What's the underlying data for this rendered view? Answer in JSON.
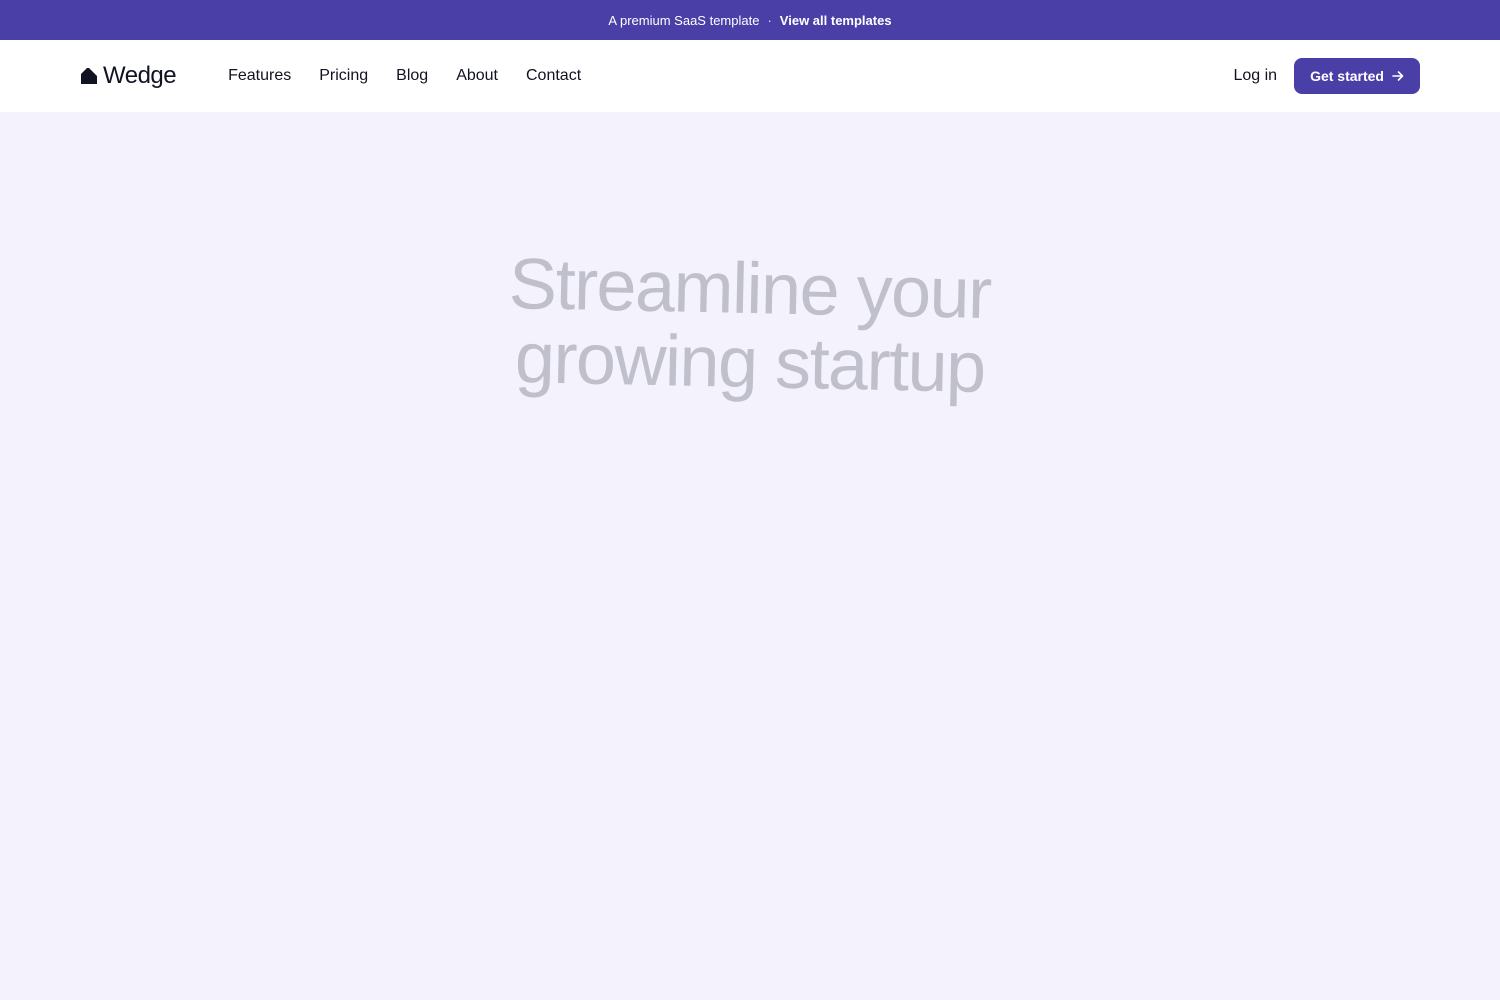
{
  "announcement": {
    "text": "A premium SaaS template",
    "separator": "·",
    "link_label": "View all templates"
  },
  "header": {
    "logo_text": "Wedge",
    "nav": [
      {
        "label": "Features"
      },
      {
        "label": "Pricing"
      },
      {
        "label": "Blog"
      },
      {
        "label": "About"
      },
      {
        "label": "Contact"
      }
    ],
    "login_label": "Log in",
    "cta_label": "Get started"
  },
  "hero": {
    "title_line1": "Streamline your",
    "title_line2": "growing startup"
  },
  "icons": {
    "logo": "wedge-logo-icon",
    "cta_arrow": "arrow-right-icon"
  },
  "colors": {
    "brand": "#4a3fa6",
    "background": "#f4f3fd",
    "hero_text": "#bfc0cc",
    "nav_text": "#111322"
  }
}
